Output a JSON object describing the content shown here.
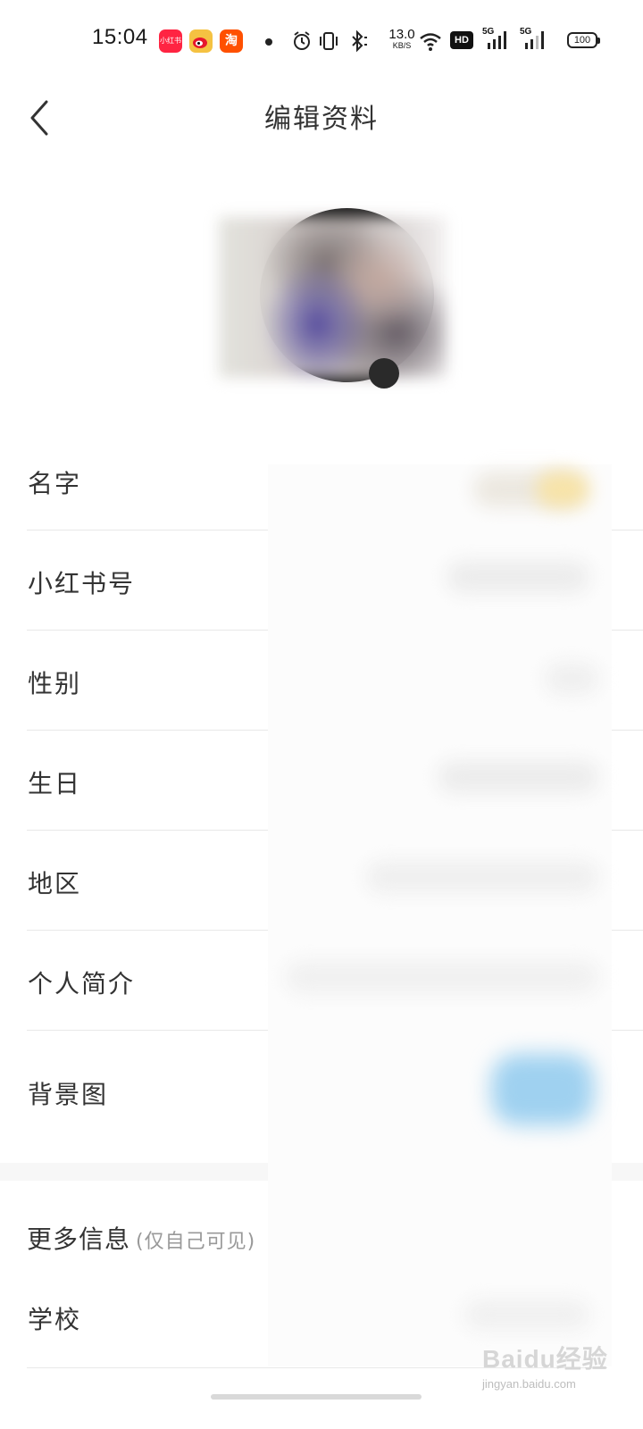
{
  "status_bar": {
    "time": "15:04",
    "apps": [
      {
        "name": "xiaohongshu-app-icon",
        "label": "小红书",
        "color": "#ff2442"
      },
      {
        "name": "weibo-app-icon",
        "label": "",
        "color": "#f5c242"
      },
      {
        "name": "taobao-app-icon",
        "label": "淘",
        "color": "#ff5000"
      }
    ],
    "net_speed_value": "13.0",
    "net_speed_unit": "KB/S",
    "hd_label": "HD",
    "signal_label_1": "5G",
    "signal_label_2": "5G",
    "battery": "100"
  },
  "header": {
    "title": "编辑资料",
    "back_icon": "chevron-left-icon"
  },
  "profile_fields": [
    {
      "label": "名字"
    },
    {
      "label": "小红书号"
    },
    {
      "label": "性别"
    },
    {
      "label": "生日"
    },
    {
      "label": "地区"
    },
    {
      "label": "个人简介"
    },
    {
      "label": "背景图"
    }
  ],
  "more_info": {
    "title": "更多信息",
    "subtitle": "(仅自己可见)",
    "school_label": "学校"
  },
  "watermark": {
    "text": "Baidu经验",
    "url": "jingyan.baidu.com"
  },
  "colors": {
    "background": "#ffffff",
    "text_primary": "#333333",
    "text_secondary": "#999999",
    "divider": "#e8e8e8",
    "section_gap": "#f7f7f7"
  }
}
